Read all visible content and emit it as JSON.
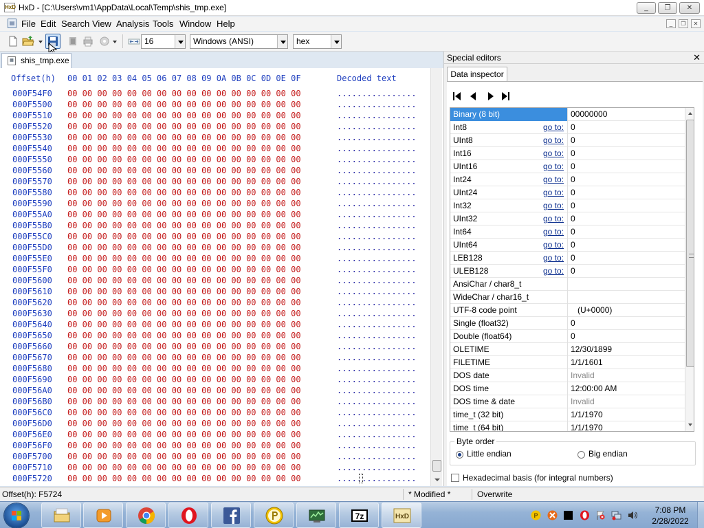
{
  "window": {
    "title": "HxD - [C:\\Users\\vm1\\AppData\\Local\\Temp\\shis_tmp.exe]",
    "caption_min": "_",
    "caption_max": "❐",
    "caption_close": "✕"
  },
  "menu": [
    "File",
    "Edit",
    "Search",
    "View",
    "Analysis",
    "Tools",
    "Window",
    "Help"
  ],
  "toolbar": {
    "bytes_per_row": "16",
    "charset": "Windows (ANSI)",
    "base": "hex"
  },
  "document_tab": "shis_tmp.exe",
  "hex_view": {
    "offset_header": "Offset(h)",
    "column_headers": [
      "00",
      "01",
      "02",
      "03",
      "04",
      "05",
      "06",
      "07",
      "08",
      "09",
      "0A",
      "0B",
      "0C",
      "0D",
      "0E",
      "0F"
    ],
    "decoded_header": "Decoded text",
    "byte_row_text": "00 00 00 00 00 00 00 00 00 00 00 00 00 00 00 00",
    "decoded_row_text": "................",
    "offsets": [
      "000F54F0",
      "000F5500",
      "000F5510",
      "000F5520",
      "000F5530",
      "000F5540",
      "000F5550",
      "000F5560",
      "000F5570",
      "000F5580",
      "000F5590",
      "000F55A0",
      "000F55B0",
      "000F55C0",
      "000F55D0",
      "000F55E0",
      "000F55F0",
      "000F5600",
      "000F5610",
      "000F5620",
      "000F5630",
      "000F5640",
      "000F5650",
      "000F5660",
      "000F5670",
      "000F5680",
      "000F5690",
      "000F56A0",
      "000F56B0",
      "000F56C0",
      "000F56D0",
      "000F56E0",
      "000F56F0",
      "000F5700",
      "000F5710",
      "000F5720"
    ]
  },
  "special_editors": {
    "title": "Special editors",
    "close": "✕",
    "tab": "Data inspector",
    "goto_label": "go to:",
    "rows": [
      {
        "name": "Binary (8 bit)",
        "value": "00000000",
        "goto": false,
        "selected": true
      },
      {
        "name": "Int8",
        "value": "0",
        "goto": true
      },
      {
        "name": "UInt8",
        "value": "0",
        "goto": true
      },
      {
        "name": "Int16",
        "value": "0",
        "goto": true
      },
      {
        "name": "UInt16",
        "value": "0",
        "goto": true
      },
      {
        "name": "Int24",
        "value": "0",
        "goto": true
      },
      {
        "name": "UInt24",
        "value": "0",
        "goto": true
      },
      {
        "name": "Int32",
        "value": "0",
        "goto": true
      },
      {
        "name": "UInt32",
        "value": "0",
        "goto": true
      },
      {
        "name": "Int64",
        "value": "0",
        "goto": true
      },
      {
        "name": "UInt64",
        "value": "0",
        "goto": true
      },
      {
        "name": "LEB128",
        "value": "0",
        "goto": true
      },
      {
        "name": "ULEB128",
        "value": "0",
        "goto": true
      },
      {
        "name": "AnsiChar / char8_t",
        "value": "",
        "goto": false
      },
      {
        "name": "WideChar / char16_t",
        "value": "",
        "goto": false
      },
      {
        "name": "UTF-8 code point",
        "value": "   (U+0000)",
        "goto": false
      },
      {
        "name": "Single (float32)",
        "value": "0",
        "goto": false
      },
      {
        "name": "Double (float64)",
        "value": "0",
        "goto": false
      },
      {
        "name": "OLETIME",
        "value": "12/30/1899",
        "goto": false
      },
      {
        "name": "FILETIME",
        "value": "1/1/1601",
        "goto": false
      },
      {
        "name": "DOS date",
        "value": "Invalid",
        "goto": false,
        "invalid": true
      },
      {
        "name": "DOS time",
        "value": "12:00:00 AM",
        "goto": false
      },
      {
        "name": "DOS time & date",
        "value": "Invalid",
        "goto": false,
        "invalid": true
      },
      {
        "name": "time_t (32 bit)",
        "value": "1/1/1970",
        "goto": false
      },
      {
        "name": "time_t (64 bit)",
        "value": "1/1/1970",
        "goto": false
      }
    ],
    "byte_order_label": "Byte order",
    "little_endian": "Little endian",
    "big_endian": "Big endian",
    "byte_order_selected": "little",
    "hex_basis_label": "Hexadecimal basis (for integral numbers)",
    "hex_basis_checked": false
  },
  "status_bar": {
    "offset": "Offset(h): F5724",
    "modified": "* Modified *",
    "mode": "Overwrite"
  },
  "taskbar": {
    "time": "7:08 PM",
    "date": "2/28/2022",
    "apps": [
      "file-explorer",
      "media-player",
      "chrome",
      "opera",
      "facebook",
      "p-app",
      "system-monitor",
      "7zip",
      "hxd"
    ]
  },
  "colors": {
    "offset_blue": "#1f3fbf",
    "byte_red": "#c41a1a",
    "selection": "#3b8ede"
  }
}
